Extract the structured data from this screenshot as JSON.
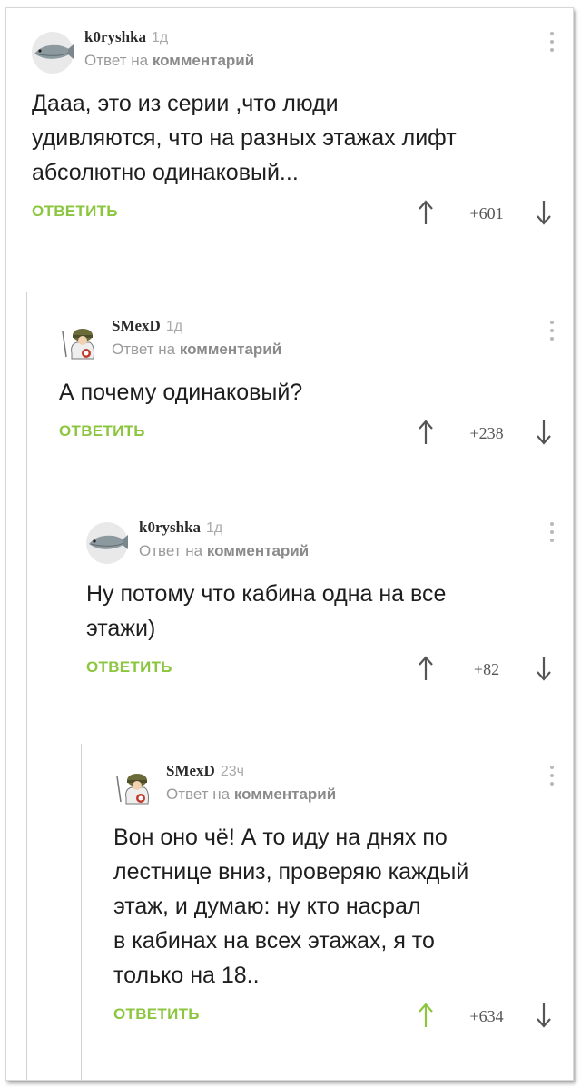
{
  "colors": {
    "accent": "#8cc63f",
    "muted": "#9a9a9a",
    "thread_line": "#d0d0d0"
  },
  "labels": {
    "reply_prefix": "Ответ на",
    "reply_target": "комментарий",
    "reply_button": "ОТВЕТИТЬ"
  },
  "comments": [
    {
      "author": "k0ryshka",
      "avatar_icon": "fish-avatar-icon",
      "time": "1д",
      "text": "Дааа, это из серии ,что люди\nудивляются, что на разных этажах лифт\nабсолютно одинаковый...",
      "score": "+601"
    },
    {
      "author": "SMexD",
      "avatar_icon": "soldier-avatar-icon",
      "time": "1д",
      "text": "А почему одинаковый?",
      "score": "+238"
    },
    {
      "author": "k0ryshka",
      "avatar_icon": "fish-avatar-icon",
      "time": "1д",
      "text": "Ну потому что кабина одна на все\nэтажи)",
      "score": "+82"
    },
    {
      "author": "SMexD",
      "avatar_icon": "soldier-avatar-icon",
      "time": "23ч",
      "text": "Вон оно чё! А то иду на днях по\nлестнице вниз, проверяю каждый\nэтаж, и думаю: ну кто насрал\nв кабинах на всех этажах, я то\nтолько на 18..",
      "score": "+634",
      "upvoted": true
    }
  ]
}
